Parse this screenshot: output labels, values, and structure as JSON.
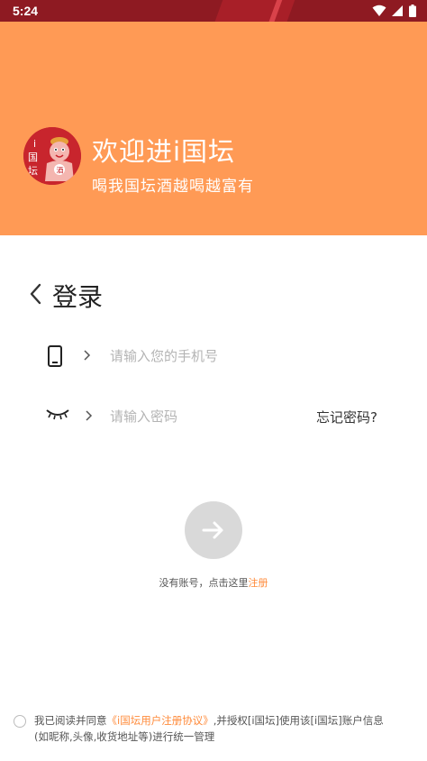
{
  "status_bar": {
    "time": "5:24",
    "icons": [
      "wifi-icon",
      "signal-icon",
      "battery-icon"
    ]
  },
  "banner": {
    "title": "欢迎进i国坛",
    "subtitle": "喝我国坛酒越喝越富有",
    "logo_text": [
      "i",
      "国",
      "坛"
    ],
    "background_color": "#ff9a55"
  },
  "page": {
    "title": "登录"
  },
  "phone_field": {
    "placeholder": "请输入您的手机号",
    "value": "",
    "icon": "phone-icon"
  },
  "password_field": {
    "placeholder": "请输入密码",
    "value": "",
    "icon": "eye-closed-icon"
  },
  "forgot_password": "忘记密码?",
  "submit": {
    "icon": "arrow-right-icon"
  },
  "register": {
    "prefix": "没有账号，点击这里",
    "link": "注册"
  },
  "agreement": {
    "prefix": "我已阅读并同意",
    "link": "《i国坛用户注册协议》",
    "suffix": ",并授权[i国坛]使用该[i国坛]账户信息 (如昵称,头像,收货地址等)进行统一管理",
    "checked": false
  },
  "accent_color": "#ff8b3b"
}
